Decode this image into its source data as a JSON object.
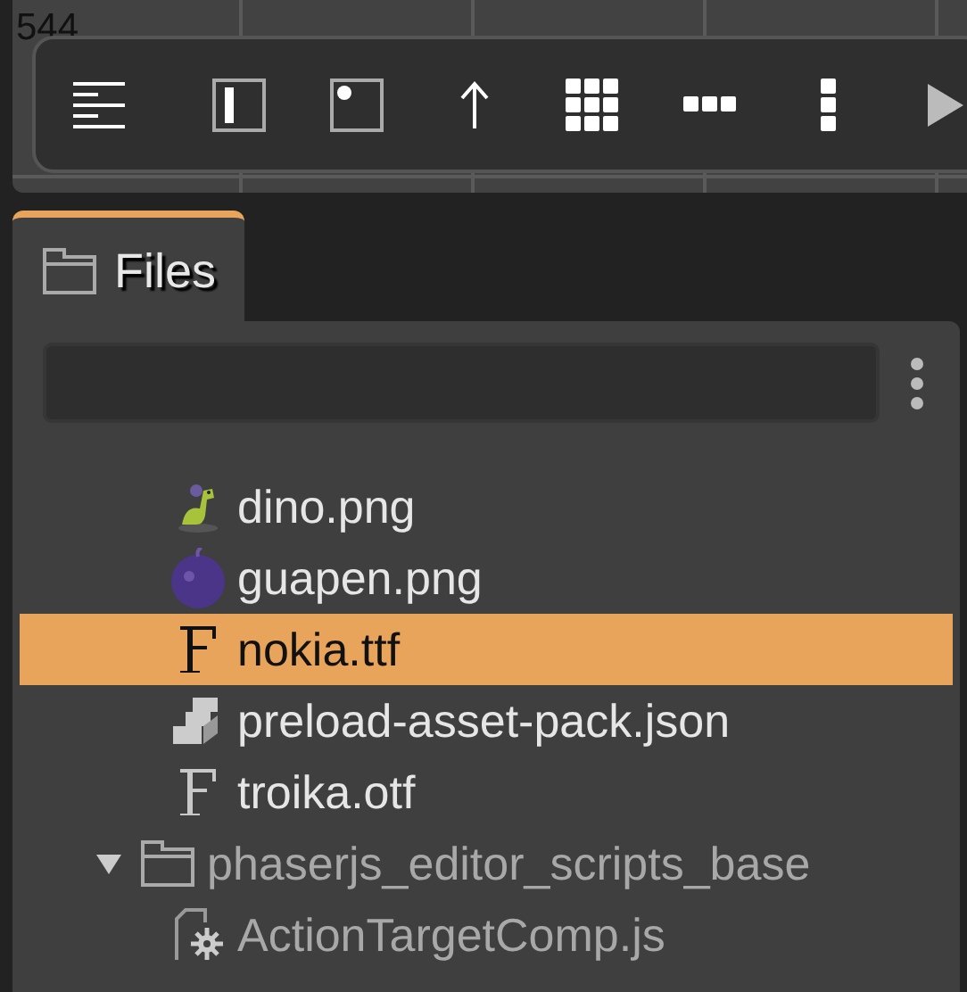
{
  "canvas": {
    "ruler_label": "544"
  },
  "toolbar": {
    "tools": [
      {
        "kind": "lines"
      },
      {
        "kind": "panel-bar"
      },
      {
        "kind": "panel-dot"
      },
      {
        "kind": "arrow-up"
      },
      {
        "kind": "grid"
      },
      {
        "kind": "row"
      },
      {
        "kind": "column"
      },
      {
        "kind": "play"
      }
    ]
  },
  "files_panel": {
    "tab": {
      "label": "Files",
      "selected": true
    },
    "filter": {
      "kind": "search"
    },
    "tree": {
      "continued_children": [
        {
          "name": "dino.png",
          "kind": "dino-image",
          "selected": false,
          "dimmed": false
        },
        {
          "name": "guapen.png",
          "kind": "fruit-image",
          "selected": false,
          "dimmed": false
        },
        {
          "name": "nokia.ttf",
          "kind": "font",
          "selected": true,
          "dimmed": false
        },
        {
          "name": "preload-asset-pack.json",
          "kind": "asset-pack",
          "selected": false,
          "dimmed": false
        },
        {
          "name": "troika.otf",
          "kind": "font",
          "selected": false,
          "dimmed": false
        }
      ],
      "items": [
        {
          "name": "phaserjs_editor_scripts_base",
          "kind": "folder",
          "expanded": true,
          "selected": false,
          "dimmed": true,
          "children": [
            {
              "name": "ActionTargetComp.js",
              "kind": "script",
              "selected": false,
              "dimmed": true
            }
          ]
        }
      ]
    }
  }
}
